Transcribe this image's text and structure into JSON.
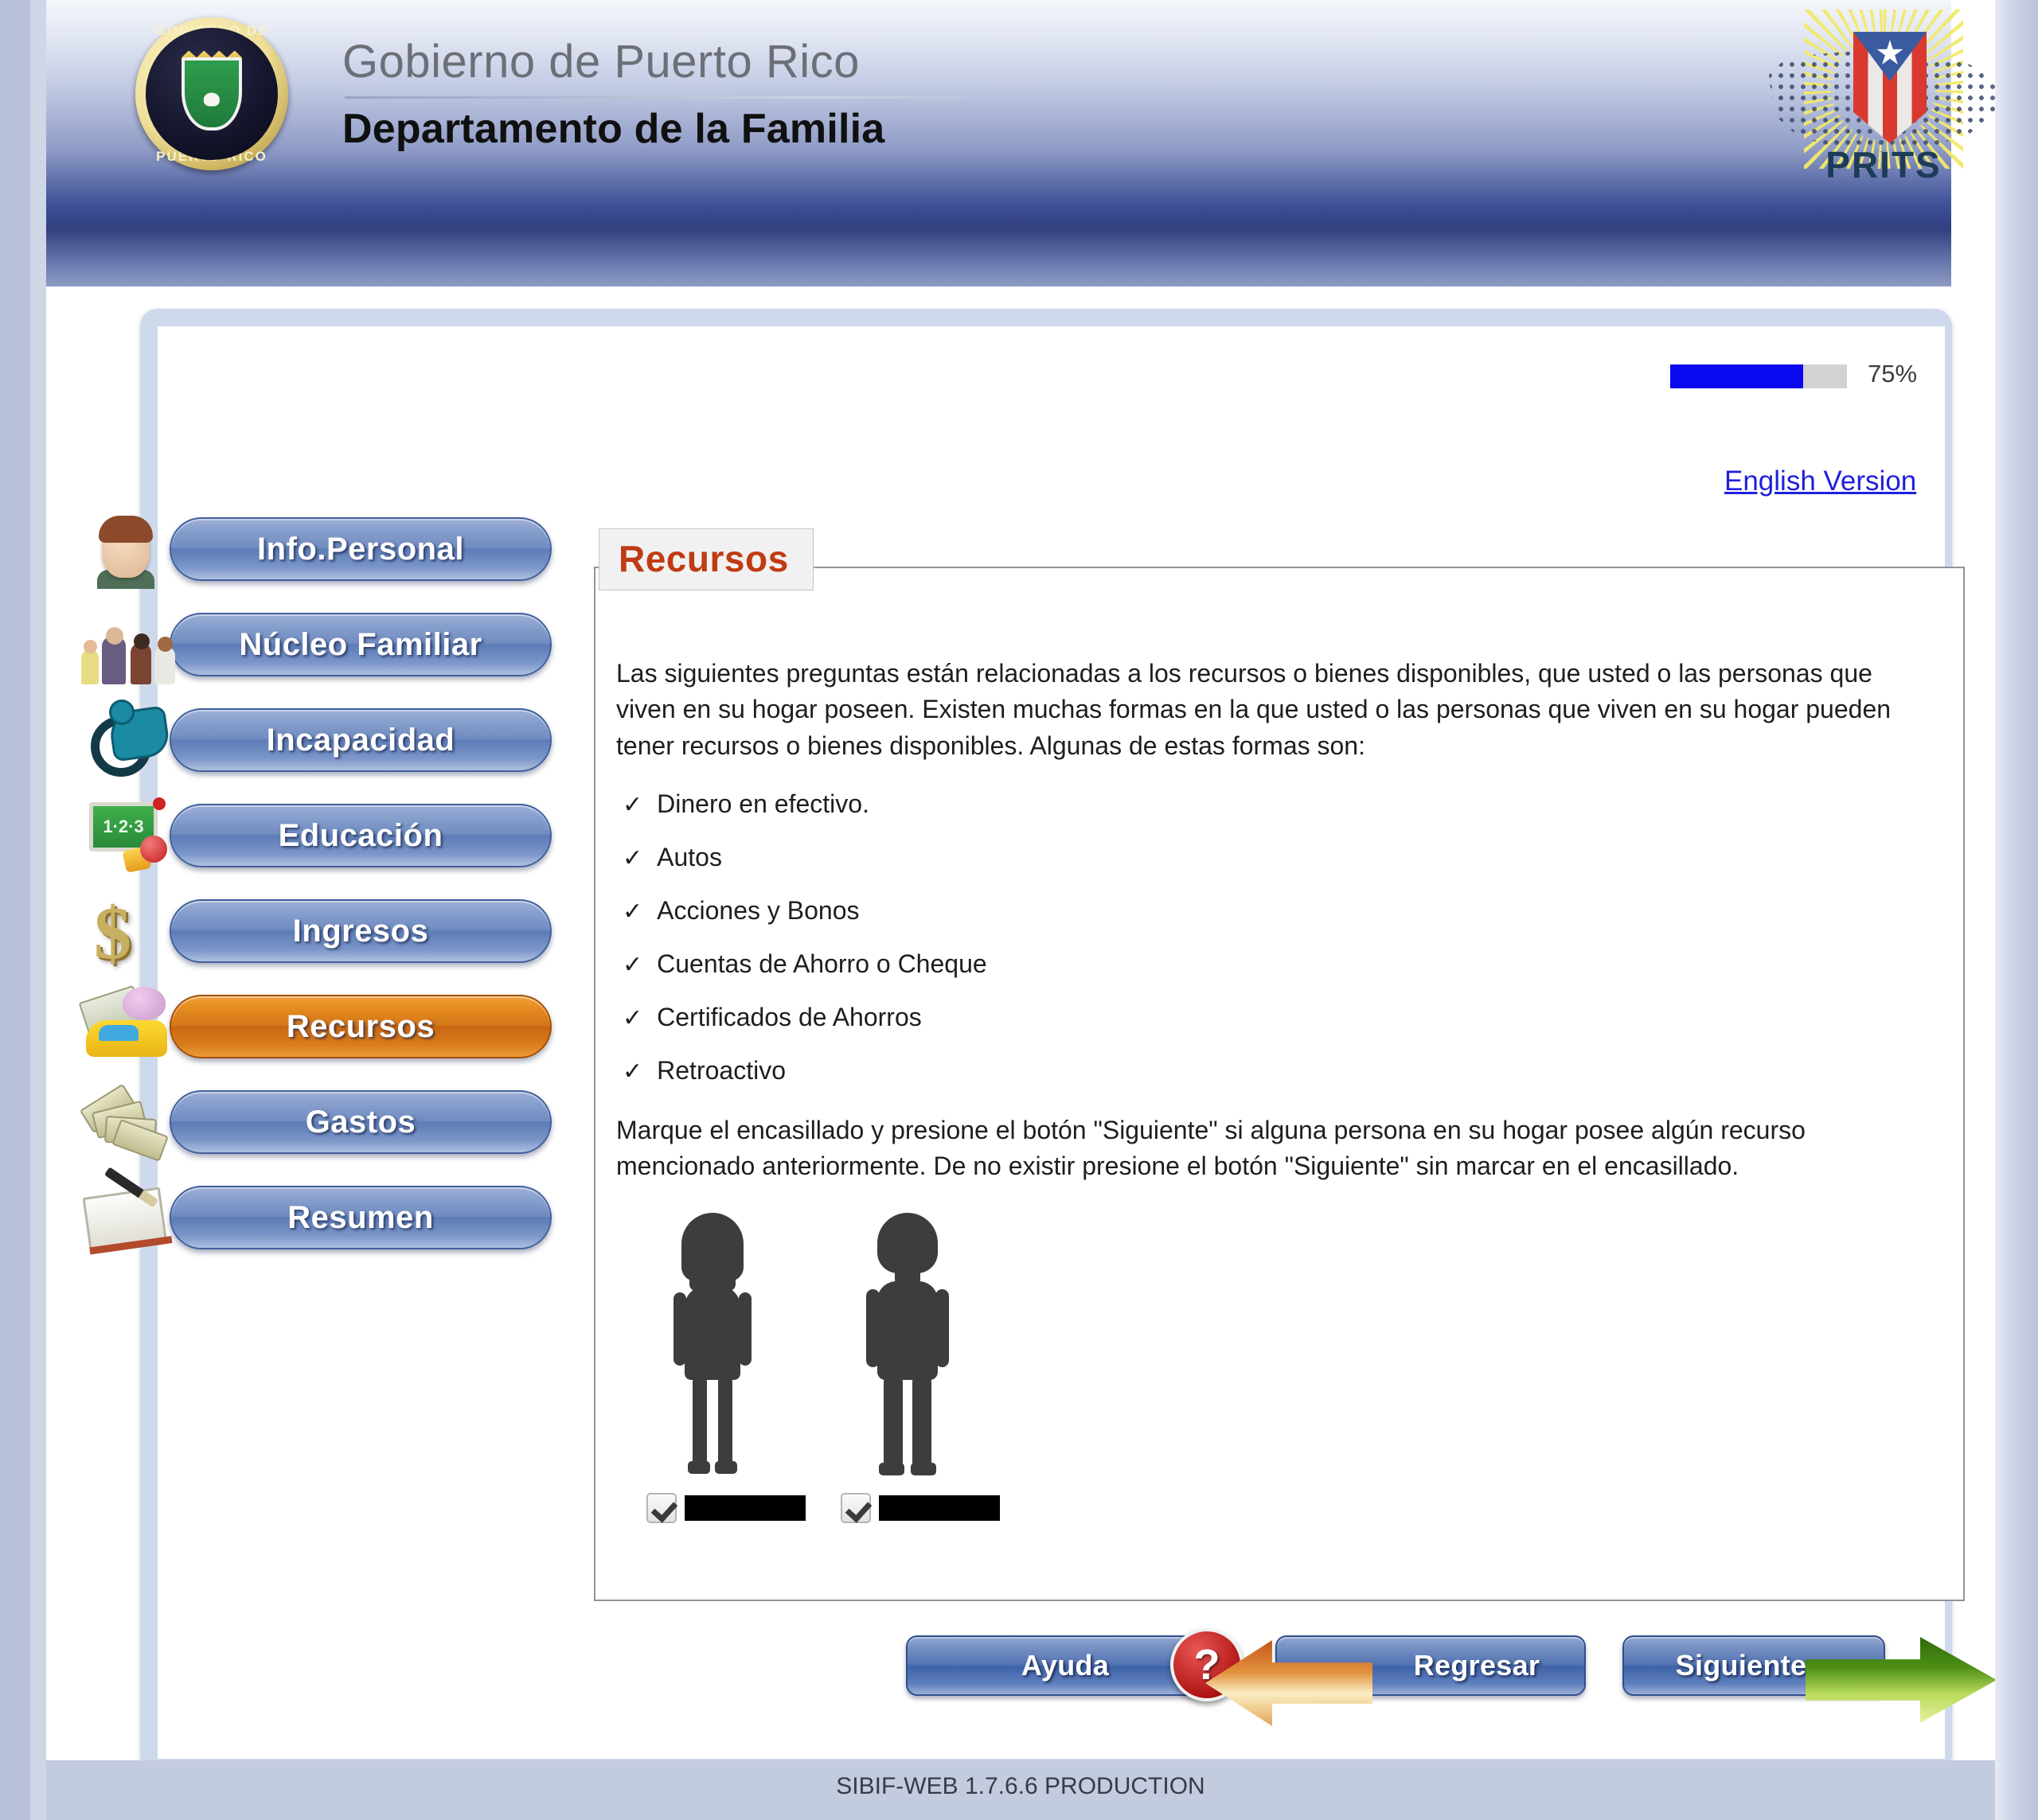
{
  "header": {
    "gov_title": "Gobierno de Puerto Rico",
    "dept_title": "Departamento de la Familia",
    "seal_text_top": "GOBIERNO DE",
    "seal_text_bottom": "PUERTO RICO",
    "logo_word": "PRITS"
  },
  "progress": {
    "percent_label": "75%",
    "value": 75,
    "fill_color": "#0a08ef",
    "track_color": "#d2d2d2"
  },
  "language": {
    "link_label": "English Version"
  },
  "sidebar": {
    "items": [
      {
        "label": "Info.Personal",
        "icon": "person-head-icon",
        "active": false
      },
      {
        "label": "Núcleo Familiar",
        "icon": "family-group-icon",
        "active": false
      },
      {
        "label": "Incapacidad",
        "icon": "wheelchair-icon",
        "active": false
      },
      {
        "label": "Educación",
        "icon": "chalkboard-icon",
        "active": false
      },
      {
        "label": "Ingresos",
        "icon": "dollar-sign-icon",
        "active": false
      },
      {
        "label": "Recursos",
        "icon": "resources-car-piggybank-icon",
        "active": true
      },
      {
        "label": "Gastos",
        "icon": "money-fan-icon",
        "active": false
      },
      {
        "label": "Resumen",
        "icon": "notepad-pen-icon",
        "active": false
      }
    ],
    "active_color": "#d4761a",
    "inactive_color": "#5c7cb6"
  },
  "panel": {
    "legend": "Recursos",
    "legend_color": "#c03b12",
    "intro_paragraph": "Las siguientes preguntas están relacionadas a los recursos o bienes disponibles, que usted o las personas que viven en su hogar poseen. Existen muchas formas en la que usted o las personas que viven en su hogar pueden tener recursos o bienes disponibles. Algunas de estas formas son:",
    "resource_list": [
      "Dinero en efectivo.",
      "Autos",
      "Acciones y Bonos",
      "Cuentas de Ahorro o Cheque",
      "Certificados de Ahorros",
      "Retroactivo"
    ],
    "tick_glyph": "✓",
    "instruction_paragraph": "Marque el encasillado y presione el botón \"Siguiente\" si alguna persona en su hogar posee algún recurso mencionado anteriormente. De no existir presione el botón \"Siguiente\" sin marcar en el encasillado.",
    "people": [
      {
        "figure": "female-silhouette",
        "checked": true,
        "name_redacted": true,
        "name_value": ""
      },
      {
        "figure": "male-silhouette",
        "checked": true,
        "name_redacted": true,
        "name_value": ""
      }
    ]
  },
  "actions": {
    "help_label": "Ayuda",
    "help_icon": "question-mark-icon",
    "back_label": "Regresar",
    "back_icon": "arrow-left-icon",
    "next_label": "Siguiente",
    "next_icon": "arrow-right-icon"
  },
  "footer": {
    "version_text": "SIBIF-WEB 1.7.6.6 PRODUCTION"
  }
}
